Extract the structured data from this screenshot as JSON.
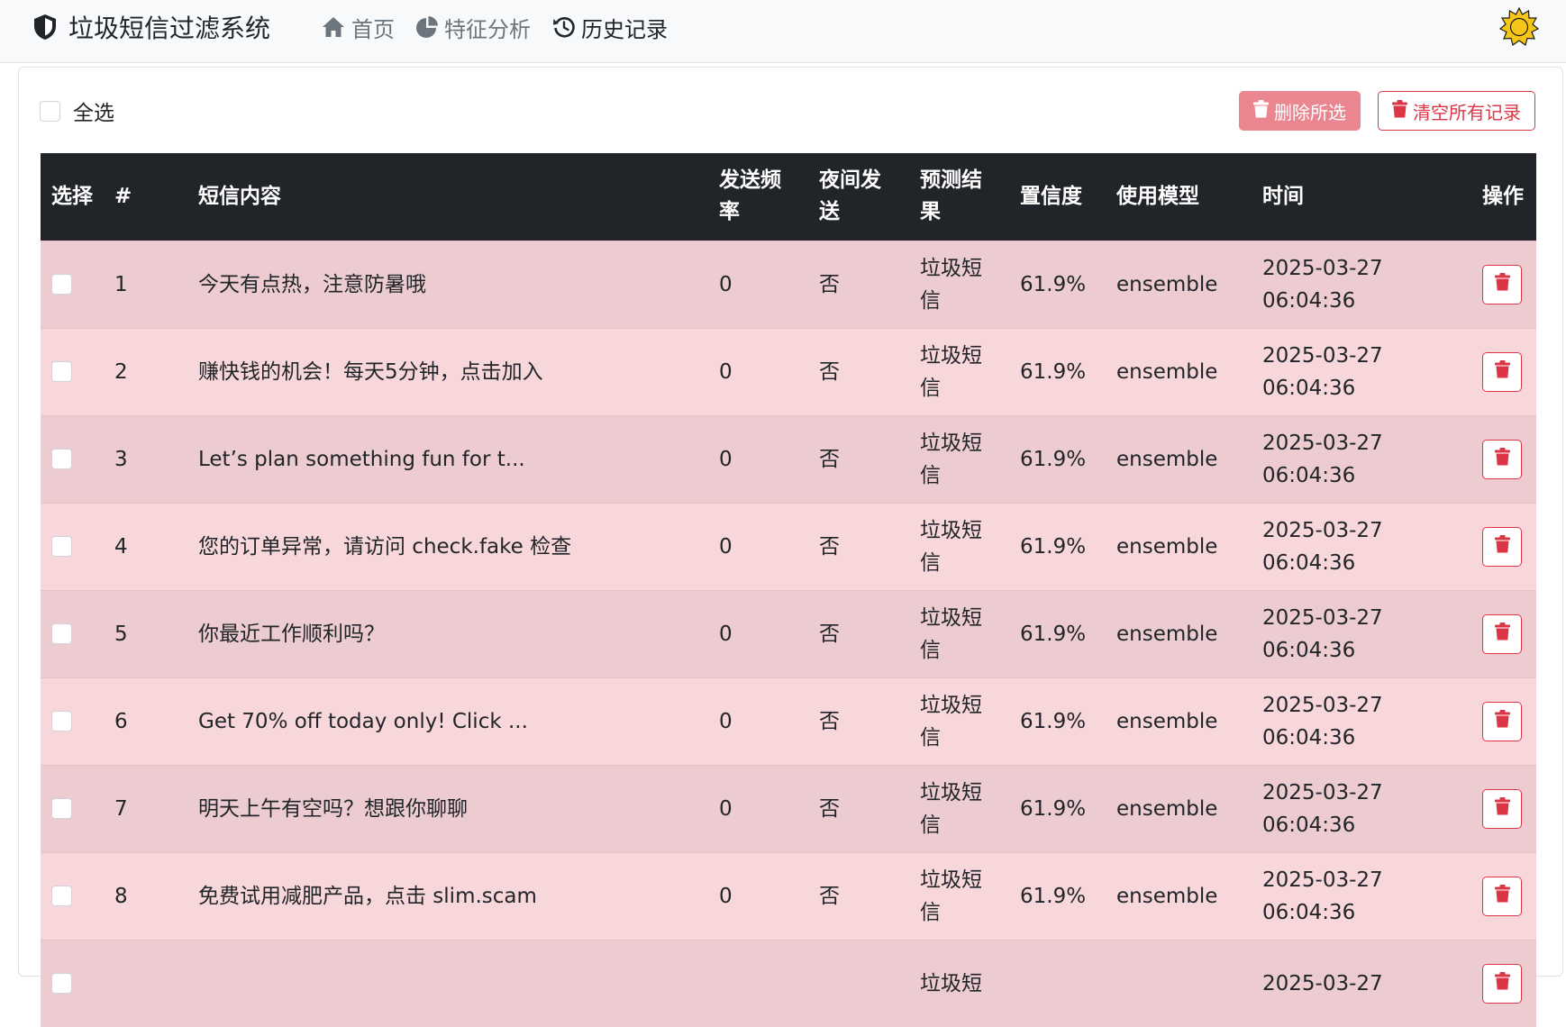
{
  "app": {
    "title": "垃圾短信过滤系统",
    "nav": [
      {
        "label": "首页",
        "icon": "home-icon",
        "active": false
      },
      {
        "label": "特征分析",
        "icon": "pie-chart-icon",
        "active": false
      },
      {
        "label": "历史记录",
        "icon": "history-icon",
        "active": true
      }
    ],
    "theme_icon": "sun-icon"
  },
  "toolbar": {
    "select_all_label": "全选",
    "delete_selected_label": "删除所选",
    "clear_all_label": "清空所有记录"
  },
  "table": {
    "headers": [
      "选择",
      "#",
      "短信内容",
      "发送频率",
      "夜间发送",
      "预测结果",
      "置信度",
      "使用模型",
      "时间",
      "操作"
    ],
    "rows": [
      {
        "id": "1",
        "content": "今天有点热，注意防暑哦",
        "freq": "0",
        "night": "否",
        "result": "垃圾短信",
        "confidence": "61.9%",
        "model": "ensemble",
        "time": "2025-03-27 06:04:36"
      },
      {
        "id": "2",
        "content": "赚快钱的机会！每天5分钟，点击加入",
        "freq": "0",
        "night": "否",
        "result": "垃圾短信",
        "confidence": "61.9%",
        "model": "ensemble",
        "time": "2025-03-27 06:04:36"
      },
      {
        "id": "3",
        "content": "Let’s plan something fun for t...",
        "freq": "0",
        "night": "否",
        "result": "垃圾短信",
        "confidence": "61.9%",
        "model": "ensemble",
        "time": "2025-03-27 06:04:36"
      },
      {
        "id": "4",
        "content": "您的订单异常，请访问 check.fake 检查",
        "freq": "0",
        "night": "否",
        "result": "垃圾短信",
        "confidence": "61.9%",
        "model": "ensemble",
        "time": "2025-03-27 06:04:36"
      },
      {
        "id": "5",
        "content": "你最近工作顺利吗？",
        "freq": "0",
        "night": "否",
        "result": "垃圾短信",
        "confidence": "61.9%",
        "model": "ensemble",
        "time": "2025-03-27 06:04:36"
      },
      {
        "id": "6",
        "content": "Get 70% off today only! Click ...",
        "freq": "0",
        "night": "否",
        "result": "垃圾短信",
        "confidence": "61.9%",
        "model": "ensemble",
        "time": "2025-03-27 06:04:36"
      },
      {
        "id": "7",
        "content": "明天上午有空吗？想跟你聊聊",
        "freq": "0",
        "night": "否",
        "result": "垃圾短信",
        "confidence": "61.9%",
        "model": "ensemble",
        "time": "2025-03-27 06:04:36"
      },
      {
        "id": "8",
        "content": "免费试用减肥产品，点击 slim.scam",
        "freq": "0",
        "night": "否",
        "result": "垃圾短信",
        "confidence": "61.9%",
        "model": "ensemble",
        "time": "2025-03-27 06:04:36"
      },
      {
        "id": "",
        "content": "",
        "freq": "",
        "night": "",
        "result": "垃圾短",
        "confidence": "",
        "model": "",
        "time": "2025-03-27"
      }
    ]
  },
  "colors": {
    "navbar_bg": "#f8f9fa",
    "table_head_bg": "#212529",
    "row_odd_bg": "#ecccd0",
    "row_even_bg": "#f8d7da",
    "danger": "#dc3545",
    "danger_light": "#ea868f",
    "sun": "#f5c518"
  }
}
